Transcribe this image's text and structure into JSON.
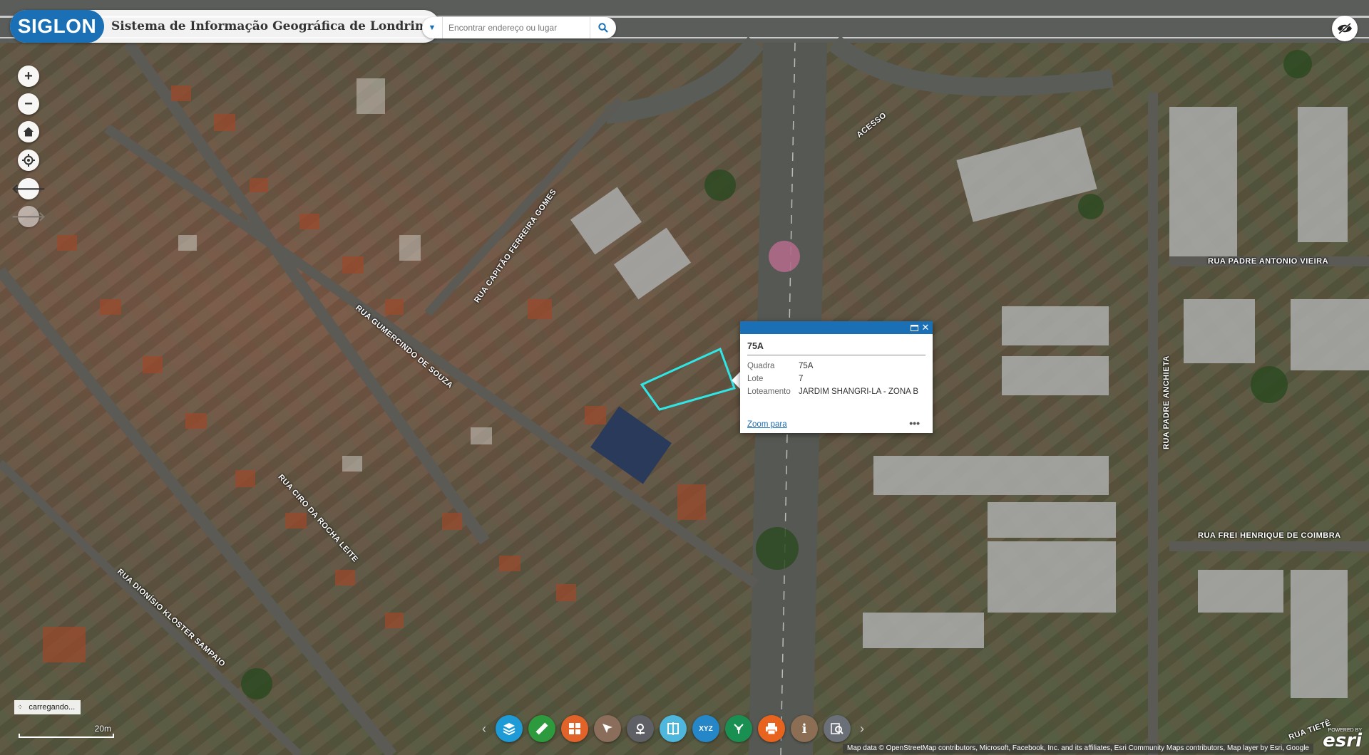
{
  "header": {
    "logo_text": "SIGLON",
    "title": "Sistema de Informação Geográfica de Londrina"
  },
  "search": {
    "placeholder": "Encontrar endereço ou lugar"
  },
  "map": {
    "road_labels": [
      "RUA CAPITÃO FERREIRA GOMES",
      "RUA GUMERCINDO DE SOUZA",
      "RUA CIRO DA ROCHA LEITE",
      "RUA DIONÍSIO KLOSTER SAMPAIO",
      "ACESSO",
      "RUA PADRE ANTONIO VIEIRA",
      "RUA PADRE ANCHIETA",
      "RUA FREI HENRIQUE DE COIMBRA",
      "RUA TIETÊ"
    ]
  },
  "popup": {
    "title": "75A",
    "rows": [
      {
        "key": "Quadra",
        "value": "75A"
      },
      {
        "key": "Lote",
        "value": "7"
      },
      {
        "key": "Loteamento",
        "value": "JARDIM SHANGRI-LA - ZONA B"
      }
    ],
    "zoom_link": "Zoom para",
    "more": "•••"
  },
  "status": {
    "loading": "carregando..."
  },
  "scale": {
    "label": "20m"
  },
  "toolbar": {
    "tools": [
      {
        "name": "layers-icon",
        "color": "#1e9bd7"
      },
      {
        "name": "measure-icon",
        "color": "#2e9a3e"
      },
      {
        "name": "basemap-gallery-icon",
        "color": "#e2632a"
      },
      {
        "name": "select-icon",
        "color": "#8a6d5a"
      },
      {
        "name": "coordinate-icon",
        "color": "#5e6066"
      },
      {
        "name": "swipe-icon",
        "color": "#4fb6dc"
      },
      {
        "name": "xyz-icon",
        "color": "#2586c8"
      },
      {
        "name": "share-icon",
        "color": "#1a8f52"
      },
      {
        "name": "print-icon",
        "color": "#e8641e"
      },
      {
        "name": "info-icon",
        "color": "#8c6e54"
      },
      {
        "name": "query-icon",
        "color": "#6b6f77"
      }
    ],
    "xyz_label": "XYZ"
  },
  "attribution": "Map data © OpenStreetMap contributors, Microsoft, Facebook, Inc. and its affiliates, Esri Community Maps contributors, Map layer by Esri, Google",
  "esri": {
    "powered": "POWERED BY",
    "brand": "esri"
  }
}
